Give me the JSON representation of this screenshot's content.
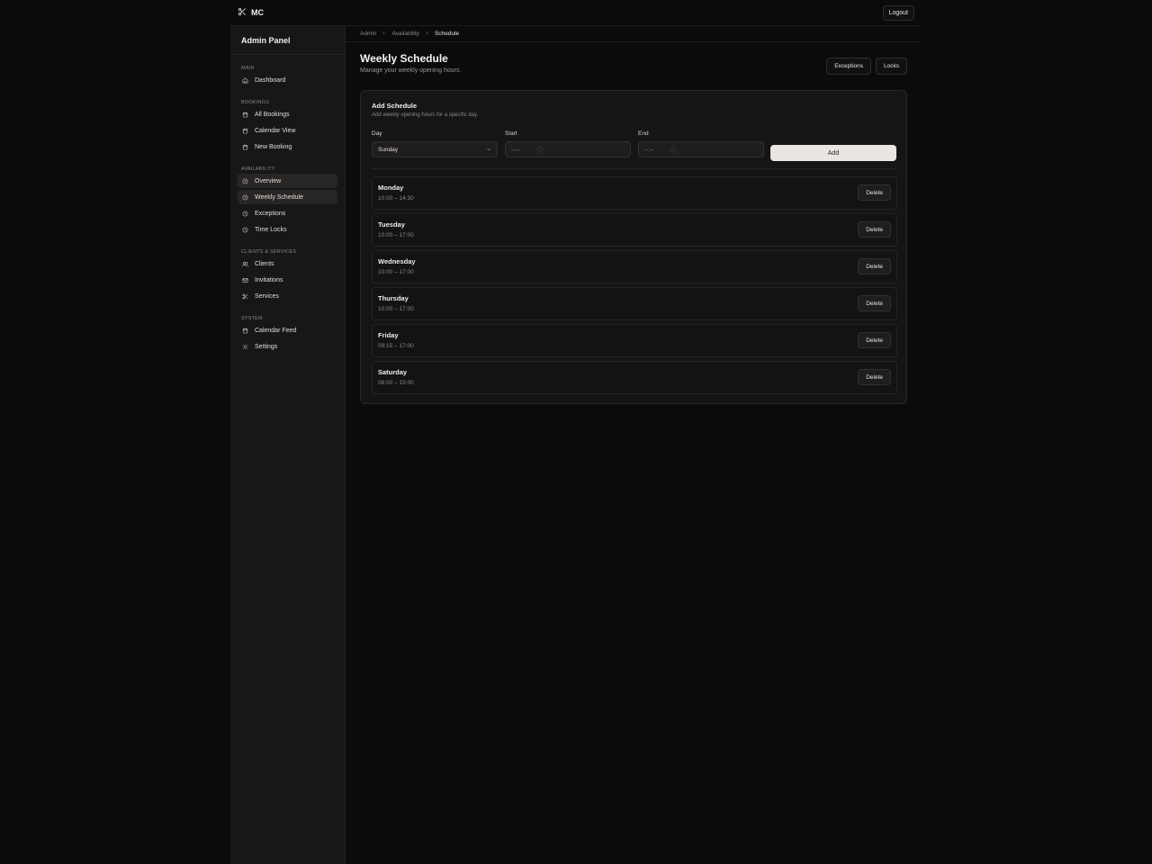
{
  "brand": {
    "name": "MC",
    "icon": "scissors-icon"
  },
  "topbar": {
    "logout_label": "Logout"
  },
  "sidebar": {
    "title": "Admin Panel",
    "groups": [
      {
        "label": "MAIN",
        "items": [
          {
            "label": "Dashboard",
            "icon": "home-icon"
          }
        ]
      },
      {
        "label": "BOOKINGS",
        "items": [
          {
            "label": "All Bookings",
            "icon": "calendar-icon"
          },
          {
            "label": "Calendar View",
            "icon": "calendar-icon"
          },
          {
            "label": "New Booking",
            "icon": "calendar-icon"
          }
        ]
      },
      {
        "label": "AVAILABILITY",
        "items": [
          {
            "label": "Overview",
            "icon": "clock-icon",
            "active": true
          },
          {
            "label": "Weekly Schedule",
            "icon": "clock-icon",
            "active": true
          },
          {
            "label": "Exceptions",
            "icon": "clock-icon"
          },
          {
            "label": "Time Locks",
            "icon": "clock-icon"
          }
        ]
      },
      {
        "label": "CLIENTS & SERVICES",
        "items": [
          {
            "label": "Clients",
            "icon": "users-icon"
          },
          {
            "label": "Invitations",
            "icon": "mail-icon"
          },
          {
            "label": "Services",
            "icon": "scissors-icon"
          }
        ]
      },
      {
        "label": "SYSTEM",
        "items": [
          {
            "label": "Calendar Feed",
            "icon": "calendar-icon"
          },
          {
            "label": "Settings",
            "icon": "gear-icon"
          }
        ]
      }
    ]
  },
  "breadcrumb": [
    "Admin",
    "Availability",
    "Schedule"
  ],
  "page": {
    "title": "Weekly Schedule",
    "subtitle": "Manage your weekly opening hours.",
    "actions": [
      "Exceptions",
      "Locks"
    ]
  },
  "add_schedule": {
    "title": "Add Schedule",
    "subtitle": "Add weekly opening hours for a specific day.",
    "day_label": "Day",
    "day_value": "Sunday",
    "start_label": "Start",
    "start_placeholder": "--:--",
    "end_label": "End",
    "end_placeholder": "--:--",
    "add_label": "Add"
  },
  "schedule": [
    {
      "day": "Monday",
      "hours": "10:00 – 14:30"
    },
    {
      "day": "Tuesday",
      "hours": "10:00 – 17:00"
    },
    {
      "day": "Wednesday",
      "hours": "10:00 – 17:00"
    },
    {
      "day": "Thursday",
      "hours": "10:00 – 17:00"
    },
    {
      "day": "Friday",
      "hours": "09:15 – 17:00"
    },
    {
      "day": "Saturday",
      "hours": "08:00 – 15:00"
    }
  ],
  "delete_label": "Delete",
  "colors": {
    "background": "#0c0b0b",
    "sidebar": "#181717",
    "active_item": "#282525",
    "primary_button": "#e9e6e2"
  }
}
